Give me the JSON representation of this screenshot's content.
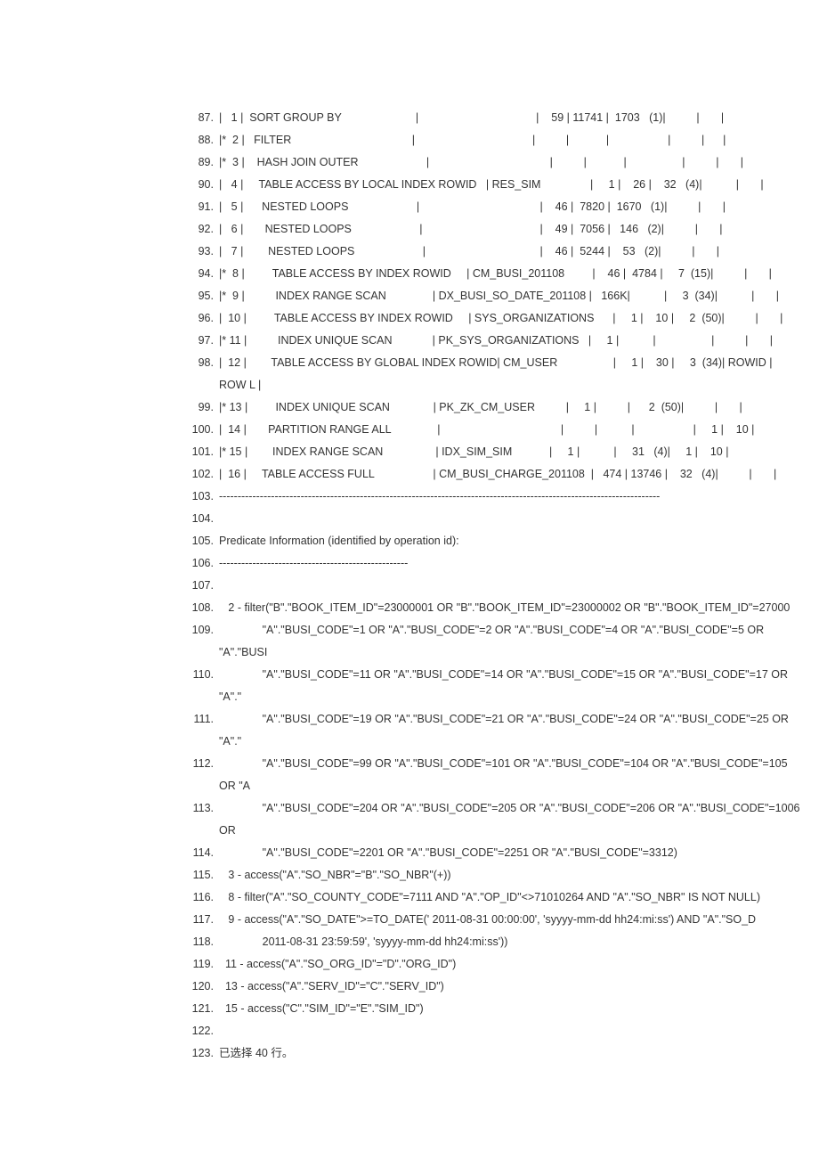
{
  "lines": [
    {
      "n": "87.",
      "t": "|   1 |  SORT GROUP BY                        |                                      |    59 | 11741 |  1703   (1)|          |       |  "
    },
    {
      "n": "88.",
      "t": "|*  2 |   FILTER                                       |                                      |          |            |                   |          |      |  "
    },
    {
      "n": "89.",
      "t": "|*  3 |    HASH JOIN OUTER                      |                                       |          |            |                  |          |       |  "
    },
    {
      "n": "90.",
      "t": "|   4 |     TABLE ACCESS BY LOCAL INDEX ROWID   | RES_SIM                |     1 |    26 |    32   (4)|           |       |  "
    },
    {
      "n": "91.",
      "t": "|   5 |      NESTED LOOPS                      |                                       |    46 |  7820 |  1670   (1)|          |       |  "
    },
    {
      "n": "92.",
      "t": "|   6 |       NESTED LOOPS                      |                                      |    49 |  7056 |   146   (2)|          |       |  "
    },
    {
      "n": "93.",
      "t": "|   7 |        NESTED LOOPS                      |                                     |    46 |  5244 |    53   (2)|          |       |  "
    },
    {
      "n": "94.",
      "t": "|*  8 |         TABLE ACCESS BY INDEX ROWID     | CM_BUSI_201108         |    46 |  4784 |     7  (15)|          |       |  "
    },
    {
      "n": "95.",
      "t": "|*  9 |          INDEX RANGE SCAN               | DX_BUSI_SO_DATE_201108 |   166K|           |     3  (34)|           |       |  "
    },
    {
      "n": "96.",
      "t": "|  10 |         TABLE ACCESS BY INDEX ROWID     | SYS_ORGANIZATIONS      |     1 |    10 |     2  (50)|          |       |  "
    },
    {
      "n": "97.",
      "t": "|* 11 |          INDEX UNIQUE SCAN             | PK_SYS_ORGANIZATIONS   |     1 |           |                  |          |       |  "
    },
    {
      "n": "98.",
      "t": "|  12 |        TABLE ACCESS BY GLOBAL INDEX ROWID| CM_USER                  |     1 |    30 |     3  (34)| ROWID | ROW L |  "
    },
    {
      "n": "99.",
      "t": "|* 13 |         INDEX UNIQUE SCAN              | PK_ZK_CM_USER          |     1 |          |      2  (50)|          |       |  "
    },
    {
      "n": "100.",
      "t": "|  14 |       PARTITION RANGE ALL               |                                       |          |           |                   |     1 |    10 |  "
    },
    {
      "n": "101.",
      "t": "|* 15 |        INDEX RANGE SCAN                 | IDX_SIM_SIM            |     1 |           |     31   (4)|     1 |    10 |  "
    },
    {
      "n": "102.",
      "t": "|  16 |     TABLE ACCESS FULL                   | CM_BUSI_CHARGE_201108  |   474 | 13746 |    32   (4)|          |       |  "
    },
    {
      "n": "103.",
      "t": "-----------------------------------------------------------------------------------------------------------------------"
    },
    {
      "n": "104.",
      "t": "   "
    },
    {
      "n": "105.",
      "t": "Predicate Information (identified by operation id):  "
    },
    {
      "n": "106.",
      "t": "---------------------------------------------------  "
    },
    {
      "n": "107.",
      "t": "   "
    },
    {
      "n": "108.",
      "t": "   2 - filter(\"B\".\"BOOK_ITEM_ID\"=23000001 OR \"B\".\"BOOK_ITEM_ID\"=23000002 OR \"B\".\"BOOK_ITEM_ID\"=27000 "
    },
    {
      "n": "109.",
      "t": "              \"A\".\"BUSI_CODE\"=1 OR \"A\".\"BUSI_CODE\"=2 OR \"A\".\"BUSI_CODE\"=4 OR \"A\".\"BUSI_CODE\"=5 OR \"A\".\"BUSI "
    },
    {
      "n": "110.",
      "t": "              \"A\".\"BUSI_CODE\"=11 OR \"A\".\"BUSI_CODE\"=14 OR \"A\".\"BUSI_CODE\"=15 OR \"A\".\"BUSI_CODE\"=17 OR \"A\".\" "
    },
    {
      "n": "111.",
      "t": "              \"A\".\"BUSI_CODE\"=19 OR \"A\".\"BUSI_CODE\"=21 OR \"A\".\"BUSI_CODE\"=24 OR \"A\".\"BUSI_CODE\"=25 OR \"A\".\" "
    },
    {
      "n": "112.",
      "t": "              \"A\".\"BUSI_CODE\"=99 OR \"A\".\"BUSI_CODE\"=101 OR \"A\".\"BUSI_CODE\"=104 OR \"A\".\"BUSI_CODE\"=105 OR \"A "
    },
    {
      "n": "113.",
      "t": "              \"A\".\"BUSI_CODE\"=204 OR \"A\".\"BUSI_CODE\"=205 OR \"A\".\"BUSI_CODE\"=206 OR \"A\".\"BUSI_CODE\"=1006 OR  "
    },
    {
      "n": "114.",
      "t": "              \"A\".\"BUSI_CODE\"=2201 OR \"A\".\"BUSI_CODE\"=2251 OR \"A\".\"BUSI_CODE\"=3312)  "
    },
    {
      "n": "115.",
      "t": "   3 - access(\"A\".\"SO_NBR\"=\"B\".\"SO_NBR\"(+))  "
    },
    {
      "n": "116.",
      "t": "   8 - filter(\"A\".\"SO_COUNTY_CODE\"=7111 AND \"A\".\"OP_ID\"<>71010264 AND \"A\".\"SO_NBR\" IS NOT NULL)  "
    },
    {
      "n": "117.",
      "t": "   9 - access(\"A\".\"SO_DATE\">=TO_DATE(' 2011-08-31 00:00:00', 'syyyy-mm-dd hh24:mi:ss') AND \"A\".\"SO_D "
    },
    {
      "n": "118.",
      "t": "              2011-08-31 23:59:59', 'syyyy-mm-dd hh24:mi:ss'))  "
    },
    {
      "n": "119.",
      "t": "  11 - access(\"A\".\"SO_ORG_ID\"=\"D\".\"ORG_ID\")  "
    },
    {
      "n": "120.",
      "t": "  13 - access(\"A\".\"SERV_ID\"=\"C\".\"SERV_ID\")  "
    },
    {
      "n": "121.",
      "t": "  15 - access(\"C\".\"SIM_ID\"=\"E\".\"SIM_ID\")  "
    },
    {
      "n": "122.",
      "t": "   "
    },
    {
      "n": "123.",
      "t": "已选择 40 行。  "
    }
  ]
}
